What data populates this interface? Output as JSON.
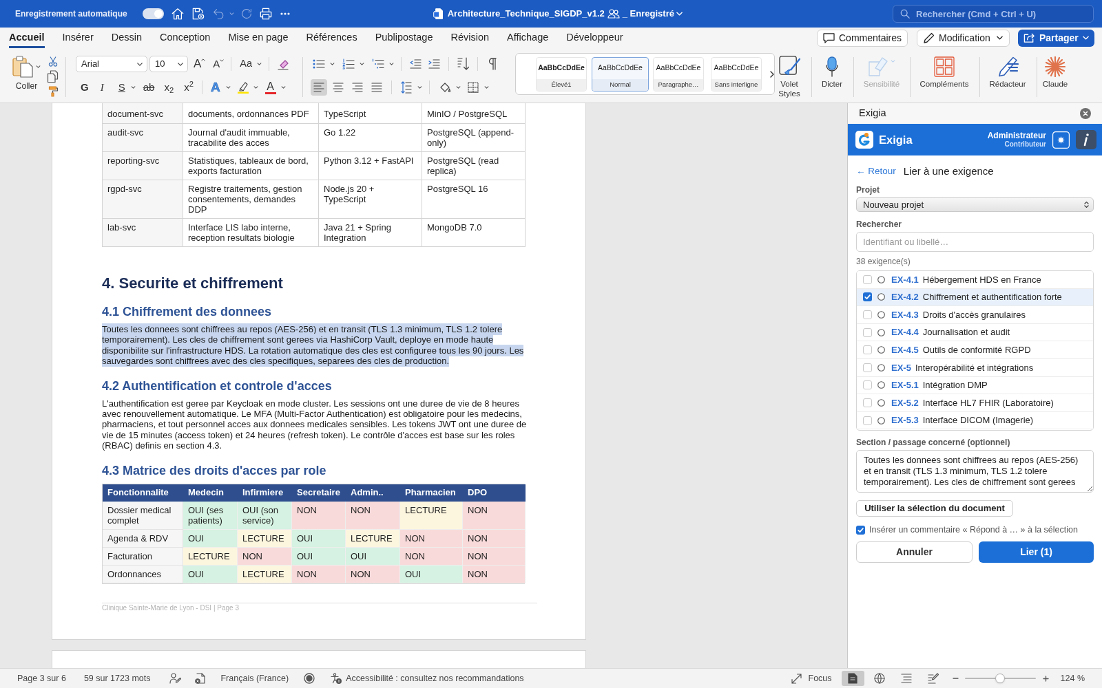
{
  "title_bar": {
    "autosave_label": "Enregistrement automatique",
    "autosave_on": true,
    "undo_disabled": true,
    "redo_disabled": true,
    "document_title": "Architecture_Technique_SIGDP_v1.2",
    "save_status": "_ Enregistré",
    "search": {
      "placeholder": "Rechercher (Cmd + Ctrl + U)"
    }
  },
  "tabs": [
    {
      "label": "Accueil",
      "selected": true
    },
    {
      "label": "Insérer",
      "selected": false
    },
    {
      "label": "Dessin",
      "selected": false
    },
    {
      "label": "Conception",
      "selected": false
    },
    {
      "label": "Mise en page",
      "selected": false
    },
    {
      "label": "Références",
      "selected": false
    },
    {
      "label": "Publipostage",
      "selected": false
    },
    {
      "label": "Révision",
      "selected": false
    },
    {
      "label": "Affichage",
      "selected": false
    },
    {
      "label": "Développeur",
      "selected": false
    }
  ],
  "tab_actions": [
    {
      "kind": "comments",
      "label": "Commentaires"
    },
    {
      "kind": "mode",
      "label": "Modification"
    },
    {
      "kind": "share",
      "label": "Partager"
    }
  ],
  "ribbon": {
    "paste_label": "Coller",
    "font_name": "Arial",
    "font_size": "10",
    "grow_font": "A",
    "shrink_font": "A",
    "change_case": "Aa",
    "format_buttons": [
      {
        "kind": "bold",
        "label": "G"
      },
      {
        "kind": "italic",
        "label": "I"
      },
      {
        "kind": "underline",
        "label": "S"
      },
      {
        "kind": "strikethrough",
        "label": "ab"
      },
      {
        "kind": "subscript",
        "label": "x$_{2}$"
      },
      {
        "kind": "superscript",
        "label": "x$^{2}$"
      }
    ],
    "text_effects": "A",
    "font_color": "A",
    "alignment": [
      {
        "selected": true
      },
      {
        "selected": false
      },
      {
        "selected": false
      },
      {
        "selected": false
      }
    ],
    "styles": [
      {
        "preview": "AaBbCcDdEe",
        "name": "Élevé1",
        "kind": "strong",
        "selected": false
      },
      {
        "preview": "AaBbCcDdEe",
        "name": "Normal",
        "kind": "plain",
        "selected": true
      },
      {
        "preview": "AaBbCcDdEe",
        "name": "Paragraphe…",
        "kind": "plain",
        "selected": false
      },
      {
        "preview": "AaBbCcDdEe",
        "name": "Sans interligne",
        "kind": "plain",
        "selected": false
      }
    ],
    "commands": [
      {
        "label": "Volet Styles",
        "disabled": false
      },
      {
        "label": "Dicter",
        "disabled": false
      },
      {
        "label": "Sensibilité",
        "disabled": true
      },
      {
        "label": "Compléments",
        "disabled": false
      },
      {
        "label": "Rédacteur",
        "disabled": false
      },
      {
        "label": "Claude",
        "disabled": false
      }
    ]
  },
  "document": {
    "blocks": [
      {
        "kind": "table",
        "rows": [
          [
            "document-svc",
            "documents, ordonnances PDF",
            "TypeScript",
            "MinIO / PostgreSQL"
          ],
          [
            "audit-svc",
            "Journal d'audit immuable, tracabilite des acces",
            "Go 1.22",
            "PostgreSQL (append-only)"
          ],
          [
            "reporting-svc",
            "Statistiques, tableaux de bord, exports facturation",
            "Python 3.12 + FastAPI",
            "PostgreSQL (read replica)"
          ],
          [
            "rgpd-svc",
            "Registre traitements, gestion consentements, demandes DDP",
            "Node.js 20 + TypeScript",
            "PostgreSQL 16"
          ],
          [
            "lab-svc",
            "Interface LIS labo interne, reception resultats biologie",
            "Java 21 + Spring Integration",
            "MongoDB 7.0"
          ]
        ]
      },
      {
        "kind": "heading1",
        "text": "4. Securite et chiffrement"
      },
      {
        "kind": "heading2",
        "text": "4.1 Chiffrement des donnees"
      },
      {
        "kind": "paragraph",
        "selected": true,
        "text": "Toutes les donnees sont chiffrees au repos (AES-256) et en transit (TLS 1.3 minimum, TLS 1.2 tolere temporairement). Les cles de chiffrement sont gerees via HashiCorp Vault, deploye en mode haute disponibilite sur l'infrastructure HDS. La rotation automatique des cles est configuree tous les 90 jours. Les sauvegardes sont chiffrees avec des cles specifiques, separees des cles de production."
      },
      {
        "kind": "heading2",
        "text": "4.2 Authentification et controle d'acces"
      },
      {
        "kind": "paragraph",
        "selected": false,
        "text": "L'authentification est geree par Keycloak en mode cluster. Les sessions ont une duree de vie de 8 heures avec renouvellement automatique. Le MFA (Multi-Factor Authentication) est obligatoire pour les medecins, pharmaciens, et tout personnel acces aux donnees medicales sensibles. Les tokens JWT ont une duree de vie de 15 minutes (access token) et 24 heures (refresh token). Le contrôle d'acces est base sur les roles (RBAC) definis en section 4.3."
      },
      {
        "kind": "heading2",
        "text": "4.3 Matrice des droits d'acces par role"
      },
      {
        "kind": "matrix",
        "columns": [
          "Fonctionnalite",
          "Medecin",
          "Infirmiere",
          "Secretaire",
          "Admin..",
          "Pharmacien",
          "DPO"
        ],
        "rows": [
          {
            "cells": [
              {
                "text": "Dossier medical complet"
              },
              {
                "text": "OUI (ses patients)",
                "color": "#d6f2e2"
              },
              {
                "text": "OUI (son service)",
                "color": "#d6f2e2"
              },
              {
                "text": "NON",
                "color": "#f9dada"
              },
              {
                "text": "NON",
                "color": "#f9dada"
              },
              {
                "text": "LECTURE",
                "color": "#fdf6df"
              },
              {
                "text": "NON",
                "color": "#f9dada"
              }
            ]
          },
          {
            "cells": [
              {
                "text": "Agenda & RDV"
              },
              {
                "text": "OUI",
                "color": "#d6f2e2"
              },
              {
                "text": "LECTURE",
                "color": "#fdf6df"
              },
              {
                "text": "OUI",
                "color": "#d6f2e2"
              },
              {
                "text": "LECTURE",
                "color": "#fdf6df"
              },
              {
                "text": "NON",
                "color": "#f9dada"
              },
              {
                "text": "NON",
                "color": "#f9dada"
              }
            ]
          },
          {
            "cells": [
              {
                "text": "Facturation"
              },
              {
                "text": "LECTURE",
                "color": "#fdf6df"
              },
              {
                "text": "NON",
                "color": "#f9dada"
              },
              {
                "text": "OUI",
                "color": "#d6f2e2"
              },
              {
                "text": "OUI",
                "color": "#d6f2e2"
              },
              {
                "text": "NON",
                "color": "#f9dada"
              },
              {
                "text": "NON",
                "color": "#f9dada"
              }
            ]
          },
          {
            "cells": [
              {
                "text": "Ordonnances"
              },
              {
                "text": "OUI",
                "color": "#d6f2e2"
              },
              {
                "text": "LECTURE",
                "color": "#fdf6df"
              },
              {
                "text": "NON",
                "color": "#f9dada"
              },
              {
                "text": "NON",
                "color": "#f9dada"
              },
              {
                "text": "OUI",
                "color": "#d6f2e2"
              },
              {
                "text": "NON",
                "color": "#f9dada"
              }
            ]
          }
        ]
      }
    ],
    "footer": "Clinique Sainte-Marie de Lyon - DSI | Page 3"
  },
  "side_panel": {
    "title": "Exigia",
    "brand": "Exigia",
    "user_name": "Administrateur",
    "user_role": "Contributeur",
    "back_link": "← Retour",
    "heading": "Lier à une exigence",
    "project_label": "Projet",
    "project_value": "Nouveau projet",
    "search_label": "Rechercher",
    "search_placeholder": "Identifiant ou libellé…",
    "count": "38 exigence(s)",
    "requirements": [
      {
        "id": "EX-4.1",
        "label": "Hébergement HDS en France",
        "checked": false,
        "selected": false
      },
      {
        "id": "EX-4.2",
        "label": "Chiffrement et authentification forte",
        "checked": true,
        "selected": true
      },
      {
        "id": "EX-4.3",
        "label": "Droits d'accès granulaires",
        "checked": false,
        "selected": false
      },
      {
        "id": "EX-4.4",
        "label": "Journalisation et audit",
        "checked": false,
        "selected": false
      },
      {
        "id": "EX-4.5",
        "label": "Outils de conformité RGPD",
        "checked": false,
        "selected": false
      },
      {
        "id": "EX-5",
        "label": "Interopérabilité et intégrations",
        "checked": false,
        "selected": false
      },
      {
        "id": "EX-5.1",
        "label": "Intégration DMP",
        "checked": false,
        "selected": false
      },
      {
        "id": "EX-5.2",
        "label": "Interface HL7 FHIR (Laboratoire)",
        "checked": false,
        "selected": false
      },
      {
        "id": "EX-5.3",
        "label": "Interface DICOM (Imagerie)",
        "checked": false,
        "selected": false
      }
    ],
    "section_label": "Section / passage concerné (optionnel)",
    "section_text": "Toutes les donnees sont chiffrees au repos (AES-256) et en transit (TLS 1.3 minimum, TLS 1.2 tolere temporairement). Les cles de chiffrement sont gerees",
    "use_selection_button": "Utiliser la sélection du document",
    "comment_option": {
      "label": "Insérer un commentaire « Répond à … » à la sélection",
      "checked": true
    },
    "buttons": [
      {
        "kind": "secondary",
        "label": "Annuler"
      },
      {
        "kind": "primary",
        "label": "Lier (1)"
      }
    ]
  },
  "status_bar": {
    "page": "Page 3 sur 6",
    "words": "59 sur 1723 mots",
    "language": "Français (France)",
    "accessibility": "Accessibilité : consultez nos recommandations",
    "focus": "Focus",
    "views": [
      {
        "selected": true
      },
      {
        "selected": false
      },
      {
        "selected": false
      },
      {
        "selected": false
      }
    ],
    "zoom": {
      "level": 0.5,
      "reading": "124 %"
    }
  }
}
